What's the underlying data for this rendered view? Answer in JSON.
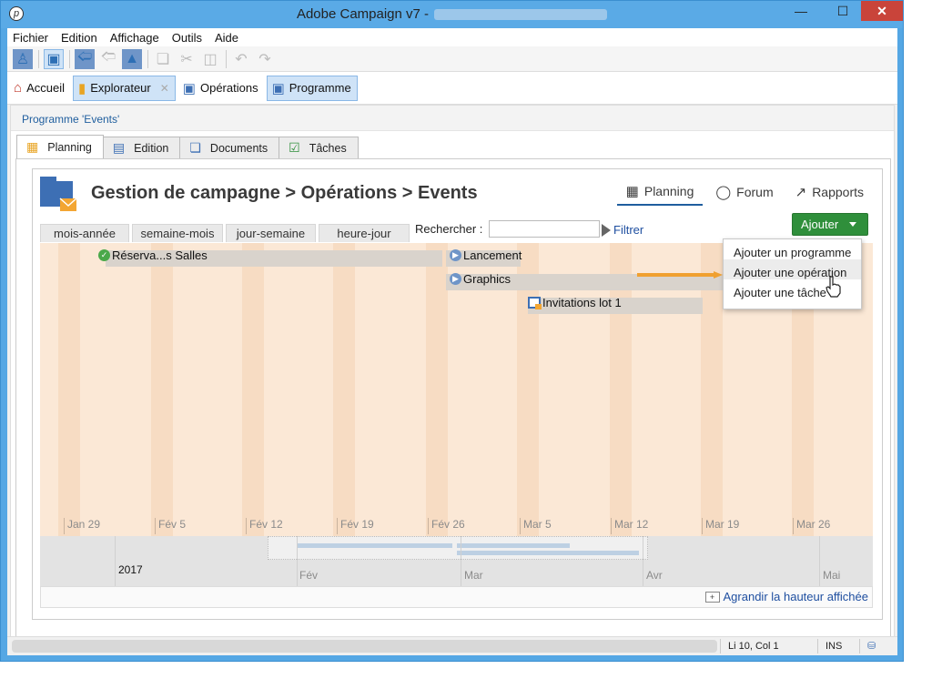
{
  "window": {
    "title": "Adobe Campaign v7 -",
    "min": "—",
    "max": "☐",
    "close": "✕"
  },
  "menu": [
    "Fichier",
    "Edition",
    "Affichage",
    "Outils",
    "Aide"
  ],
  "apptabs": {
    "home": "Accueil",
    "explorer": "Explorateur",
    "operations": "Opérations",
    "program": "Programme"
  },
  "breadcrumb": "Programme 'Events'",
  "subtabs": [
    "Planning",
    "Edition",
    "Documents",
    "Tâches"
  ],
  "header": {
    "title": "Gestion de campagne > Opérations > Events"
  },
  "viewtabs": [
    "Planning",
    "Forum",
    "Rapports"
  ],
  "ajouter": {
    "label": "Ajouter"
  },
  "scale_tabs": [
    "mois-année",
    "semaine-mois",
    "jour-semaine",
    "heure-jour"
  ],
  "search": {
    "label": "Rechercher :",
    "value": "",
    "filter": "Filtrer"
  },
  "tasks": [
    {
      "label": "Réserva...s Salles",
      "type": "done"
    },
    {
      "label": "Lancement",
      "type": "task"
    },
    {
      "label": "Graphics",
      "type": "task"
    },
    {
      "label": "Invitations lot 1",
      "type": "delivery"
    }
  ],
  "ticks": [
    "Jan 29",
    "Fév 5",
    "Fév 12",
    "Fév 19",
    "Fév 26",
    "Mar 5",
    "Mar 12",
    "Mar 19",
    "Mar 26"
  ],
  "timeline": {
    "year": "2017",
    "months": [
      "Fév",
      "Mar",
      "Avr",
      "Mai"
    ]
  },
  "enlarge": "Agrandir la hauteur affichée",
  "dropdown": [
    "Ajouter un programme",
    "Ajouter une opération",
    "Ajouter une tâche"
  ],
  "status": {
    "position": "Li 10, Col 1",
    "mode": "INS"
  },
  "colors": {
    "accent_green": "#2f8f3b",
    "gantt_bg": "#fbe8d6",
    "arrow": "#f0a030",
    "link": "#1f4fa0"
  }
}
